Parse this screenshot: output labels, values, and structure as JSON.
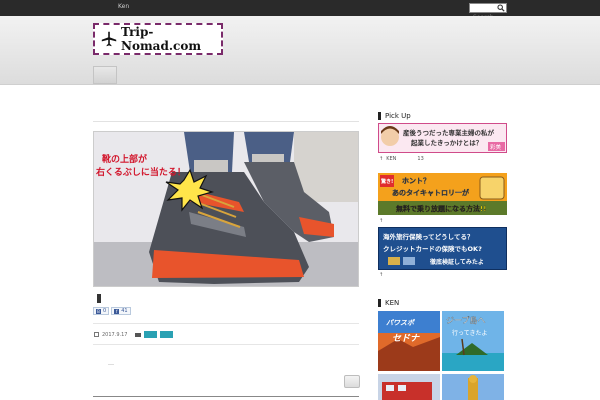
{
  "topbar": {
    "user": "Ken",
    "search_placeholder": "Search"
  },
  "header": {
    "site_name": "Trip-Nomad.com"
  },
  "post": {
    "photo_caption": "靴の上部が\n右くるぶしに当たる！",
    "photo_caption_line1": "靴の上部が",
    "photo_caption_line2": "右くるぶしに当たる！",
    "share_count_b": "0",
    "share_count_f": "41",
    "date": "2017.9.17",
    "excerpt": "…"
  },
  "sidebar": {
    "pickup_heading": "Pick Up",
    "pickup_items": [
      {
        "text_line1": "産後うつだった専業主婦の私が",
        "text_line2": "起業したきっかけとは？",
        "badge": "彩美",
        "caption_author": "KEN",
        "caption_extra": "13"
      },
      {
        "text_line1": "驚き!",
        "text_line2": "ホント？",
        "text_line3": "あのタイキャトロリーが",
        "text_line4": "無料で乗り放題になる方法!!",
        "caption_author": ""
      },
      {
        "text_line1": "海外旅行保険ってどうしてる？",
        "text_line2": "クレジットカードの保険でもOK?",
        "text_line3": "徹底検証してみたよ",
        "caption_author": ""
      }
    ],
    "ken_heading": "KEN",
    "tiles": [
      {
        "label": "パワスポ\nセドナ",
        "label_line1": "パワスポ",
        "label_line2": "セドナ"
      },
      {
        "label": "ジープ島へ\n行ってきたよ",
        "label_line1": "ジープ島へ",
        "label_line2": "行ってきたよ"
      },
      {
        "label": ""
      },
      {
        "label": ""
      }
    ]
  },
  "colors": {
    "accent": "#2aa1b3",
    "logo_border": "#7a2a6a",
    "topbar": "#2a2a2a"
  }
}
